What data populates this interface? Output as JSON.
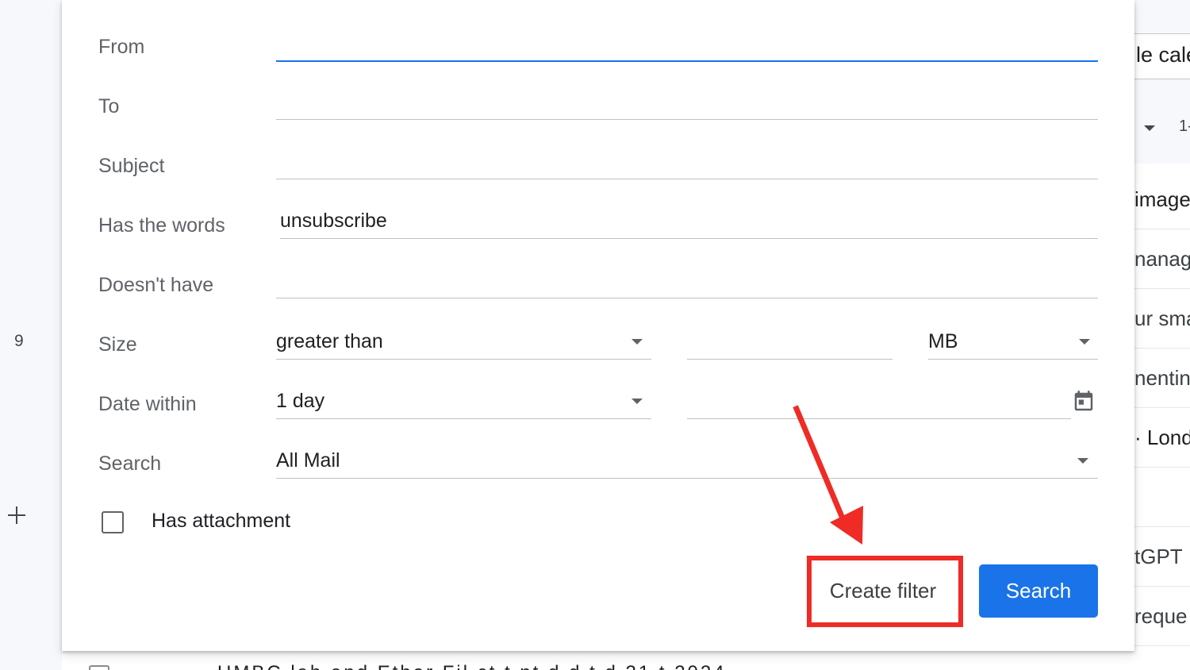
{
  "background": {
    "left_count": "9",
    "right_search_text": "le cale",
    "right_range": "1-",
    "right_rows": [
      {
        "text": "image",
        "unread": true
      },
      {
        "text": "nanag",
        "unread": false
      },
      {
        "text": "ur sma",
        "unread": false
      },
      {
        "text": "nentin",
        "unread": false
      },
      {
        "text": "· Lond",
        "unread": true
      },
      {
        "text": "",
        "unread": false
      },
      {
        "text": "tGPT",
        "unread": false
      },
      {
        "text": "reque",
        "unread": false
      }
    ],
    "bottom_peek_text": "UMBC lab and      Ether   Fil    ct   t   nt    d    d   t    d   21   t    2024"
  },
  "dialog": {
    "from": {
      "label": "From",
      "value": ""
    },
    "to": {
      "label": "To",
      "value": ""
    },
    "subject": {
      "label": "Subject",
      "value": ""
    },
    "has_words": {
      "label": "Has the words",
      "value": "unsubscribe"
    },
    "doesnt_have": {
      "label": "Doesn't have",
      "value": ""
    },
    "size": {
      "label": "Size",
      "operator": "greater than",
      "amount": "",
      "unit": "MB"
    },
    "date_within": {
      "label": "Date within",
      "range": "1 day",
      "date": ""
    },
    "search": {
      "label": "Search",
      "scope": "All Mail"
    },
    "has_attachment": {
      "label": "Has attachment",
      "checked": false
    },
    "create_filter_label": "Create filter",
    "search_button_label": "Search"
  },
  "colors": {
    "accent": "#1a73e8",
    "highlight": "#ee2c25"
  },
  "icons": [
    "calendar-icon",
    "dropdown-caret-icon",
    "plus-icon",
    "annotation-arrow"
  ]
}
